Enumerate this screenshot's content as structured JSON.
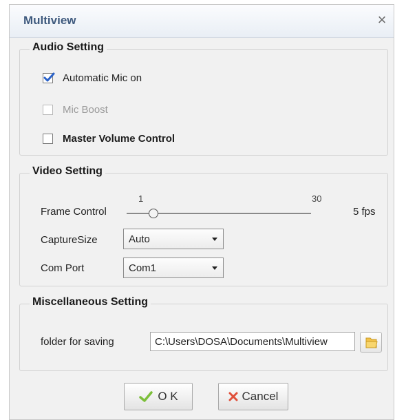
{
  "window": {
    "title": "Multiview",
    "close_glyph": "×"
  },
  "audio": {
    "title": "Audio Setting",
    "options": [
      {
        "label": "Automatic Mic on",
        "checked": true,
        "enabled": true
      },
      {
        "label": "Mic Boost",
        "checked": false,
        "enabled": false
      },
      {
        "label": "Master Volume Control",
        "checked": false,
        "enabled": true
      }
    ]
  },
  "video": {
    "title": "Video Setting",
    "frame_control": {
      "label": "Frame Control",
      "min": "1",
      "max": "30",
      "value": 5,
      "value_text": "5 fps"
    },
    "capture_size": {
      "label": "CaptureSize",
      "value": "Auto"
    },
    "com_port": {
      "label": "Com Port",
      "value": "Com1"
    }
  },
  "misc": {
    "title": "Miscellaneous Setting",
    "folder_label": "folder for saving",
    "folder_path": "C:\\Users\\DOSA\\Documents\\Multiview"
  },
  "buttons": {
    "ok": "O K",
    "cancel": "Cancel"
  },
  "icons": {
    "close": "close-icon",
    "check": "checkmark-icon",
    "folder": "folder-icon",
    "ok": "ok-check-icon",
    "cancel": "cancel-x-icon"
  },
  "colors": {
    "title": "#3f5a7e",
    "check": "#2a62c9",
    "ok_icon": "#7cbf3a",
    "cancel_icon": "#e0503a",
    "folder": "#f2c24a"
  }
}
